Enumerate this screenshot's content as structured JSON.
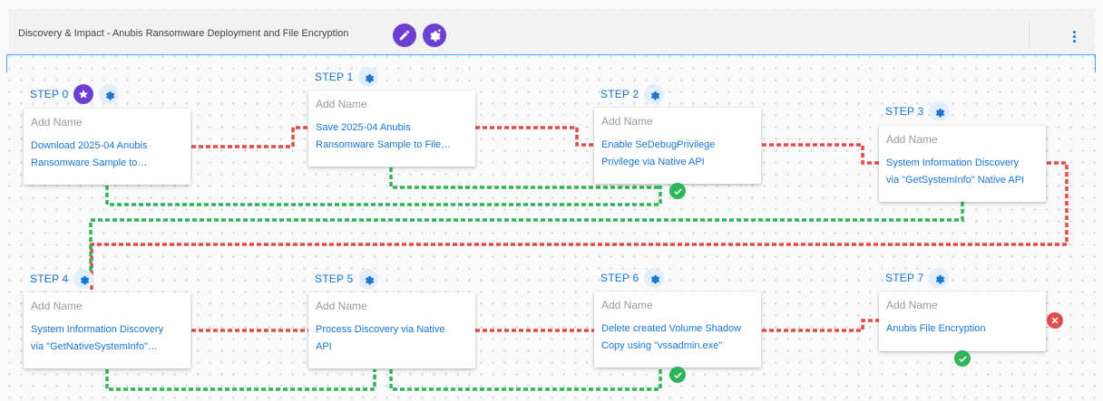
{
  "header": {
    "title": "Discovery & Impact - Anubis Ransomware Deployment and File Encryption",
    "edit_icon": "pencil-icon",
    "settings_icon": "gear-sparkle-icon",
    "menu_icon": "kebab-menu-icon"
  },
  "colors": {
    "accent": "#6c3fd1",
    "link": "#1976d2",
    "success_wire": "#2eb55a",
    "failure_wire": "#e24b4b"
  },
  "steps": [
    {
      "label": "STEP 0",
      "name_placeholder": "Add Name",
      "desc1": "Download 2025-04 Anubis",
      "desc2": "Ransomware Sample to…",
      "status": ""
    },
    {
      "label": "STEP 1",
      "name_placeholder": "Add Name",
      "desc1": "Save 2025-04 Anubis",
      "desc2": "Ransomware Sample to File…",
      "status": ""
    },
    {
      "label": "STEP 2",
      "name_placeholder": "Add Name",
      "desc1": "Enable SeDebugPrivilege",
      "desc2": "Privilege via Native API",
      "status": "success"
    },
    {
      "label": "STEP 3",
      "name_placeholder": "Add Name",
      "desc1": "System Information Discovery",
      "desc2": "via \"GetSystemInfo\" Native API",
      "status": ""
    },
    {
      "label": "STEP 4",
      "name_placeholder": "Add Name",
      "desc1": "System Information Discovery",
      "desc2": "via \"GetNativeSystemInfo\"…",
      "status": ""
    },
    {
      "label": "STEP 5",
      "name_placeholder": "Add Name",
      "desc1": "Process Discovery via Native",
      "desc2": "API",
      "status": ""
    },
    {
      "label": "STEP 6",
      "name_placeholder": "Add Name",
      "desc1": "Delete created Volume Shadow",
      "desc2": "Copy using \"vssadmin.exe\"",
      "status": "success"
    },
    {
      "label": "STEP 7",
      "name_placeholder": "Add Name",
      "desc1": "Anubis File Encryption",
      "desc2": "",
      "status": "success, failure"
    }
  ]
}
